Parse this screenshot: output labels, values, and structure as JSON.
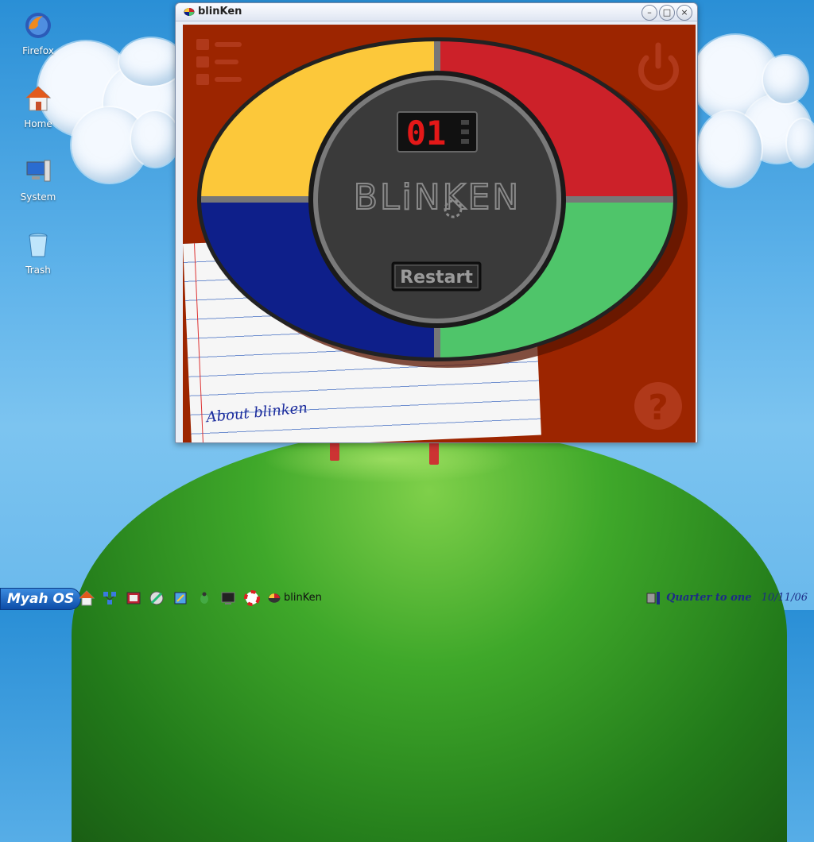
{
  "desktop": {
    "icons": [
      {
        "label": "Firefox",
        "icon": "firefox-icon"
      },
      {
        "label": "Home",
        "icon": "home-icon"
      },
      {
        "label": "System",
        "icon": "system-icon"
      },
      {
        "label": "Trash",
        "icon": "trash-icon"
      }
    ]
  },
  "window": {
    "title": "blinKen",
    "buttons": {
      "minimize": "–",
      "maximize": "□",
      "close": "×"
    }
  },
  "game": {
    "counter": "01",
    "logo": "BLiNKEN",
    "restart_label": "Restart",
    "about_label": "About blinken",
    "colors": {
      "yellow": "#fcc83a",
      "red": "#cc2129",
      "blue": "#0e1f8a",
      "green": "#4fc56a",
      "center": "#3a3a3a",
      "background": "#9c2500"
    }
  },
  "taskbar": {
    "start_label": "Myah OS",
    "task_label": "blinKen",
    "clock_text": "Quarter to one",
    "date": "10/11/06"
  }
}
